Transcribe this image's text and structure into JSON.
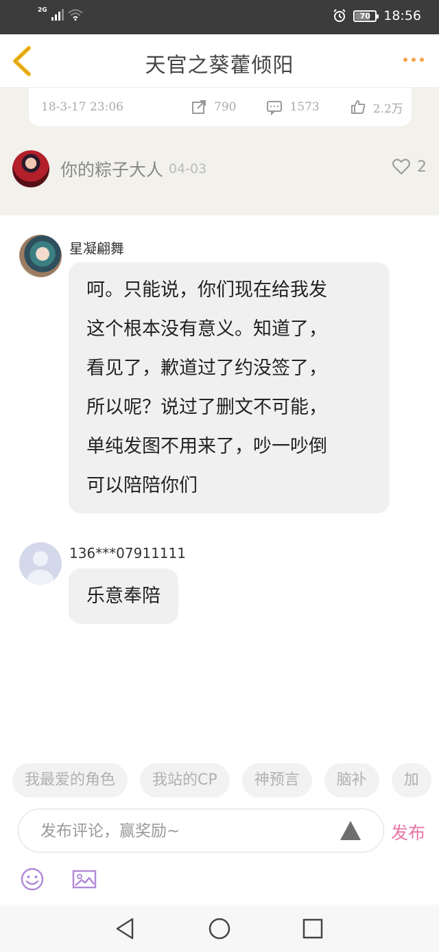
{
  "status_bar": {
    "network": "2G",
    "battery": "70",
    "time": "18:56"
  },
  "header": {
    "title": "天官之葵藿倾阳"
  },
  "post_card": {
    "date": "18-3-17 23:06",
    "shares": "790",
    "comments": "1573",
    "likes": "2.2万"
  },
  "author": {
    "name": "你的粽子大人",
    "date": "04-03",
    "like_count": "2"
  },
  "comments": [
    {
      "user": "星凝翩舞",
      "lines": [
        "呵。只能说，你们现在给我发",
        "这个根本没有意义。知道了，",
        "看见了，歉道过了约没签了，",
        "所以呢？说过了删文不可能，",
        "单纯发图不用来了，吵一吵倒",
        "可以陪陪你们"
      ]
    },
    {
      "user": "136***07911111",
      "lines": [
        "乐意奉陪"
      ]
    }
  ],
  "tags": [
    "我最爱的角色",
    "我站的CP",
    "神预言",
    "脑补",
    "加"
  ],
  "comment_input": {
    "placeholder": "发布评论，赢奖励~",
    "value": ""
  },
  "publish_label": "发布",
  "colors": {
    "accent_orange": "#f6a248",
    "publish_pink": "#e873a4",
    "tool_purple": "#b28ad6",
    "back_arrow": "#f2b51b"
  }
}
